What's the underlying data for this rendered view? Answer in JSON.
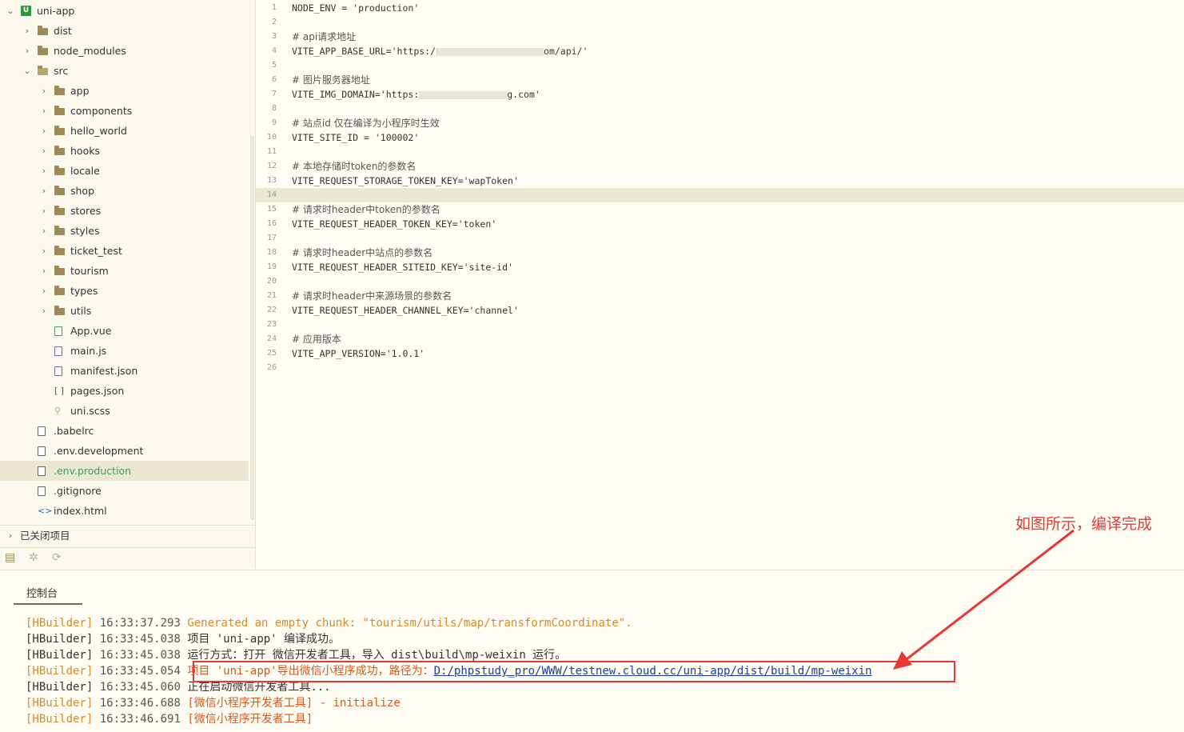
{
  "sidebar": {
    "project": {
      "label": "uni-app",
      "badge": "U"
    },
    "items": [
      {
        "label": "dist",
        "type": "folder",
        "expanded": false
      },
      {
        "label": "node_modules",
        "type": "folder",
        "expanded": false
      },
      {
        "label": "src",
        "type": "folder",
        "expanded": true
      },
      {
        "label": "app",
        "type": "folder",
        "expanded": false
      },
      {
        "label": "components",
        "type": "folder",
        "expanded": false
      },
      {
        "label": "hello_world",
        "type": "folder",
        "expanded": false
      },
      {
        "label": "hooks",
        "type": "folder",
        "expanded": false
      },
      {
        "label": "locale",
        "type": "folder",
        "expanded": false
      },
      {
        "label": "shop",
        "type": "folder",
        "expanded": false
      },
      {
        "label": "stores",
        "type": "folder",
        "expanded": false
      },
      {
        "label": "styles",
        "type": "folder",
        "expanded": false
      },
      {
        "label": "ticket_test",
        "type": "folder",
        "expanded": false
      },
      {
        "label": "tourism",
        "type": "folder",
        "expanded": false
      },
      {
        "label": "types",
        "type": "folder",
        "expanded": false
      },
      {
        "label": "utils",
        "type": "folder",
        "expanded": false
      },
      {
        "label": "App.vue",
        "type": "vue-file"
      },
      {
        "label": "main.js",
        "type": "js-file"
      },
      {
        "label": "manifest.json",
        "type": "manifest-file"
      },
      {
        "label": "pages.json",
        "type": "json-file",
        "icon_text": "[ ]"
      },
      {
        "label": "uni.scss",
        "type": "scss-file"
      },
      {
        "label": ".babelrc",
        "type": "file"
      },
      {
        "label": ".env.development",
        "type": "file"
      },
      {
        "label": ".env.production",
        "type": "file",
        "active": true
      },
      {
        "label": ".gitignore",
        "type": "file"
      },
      {
        "label": "index.html",
        "type": "html-file",
        "icon_text": "<>"
      }
    ],
    "closed_projects": "已关闭项目"
  },
  "editor": {
    "current_line": 14,
    "lines": [
      {
        "n": "1",
        "text": "NODE_ENV = 'production'"
      },
      {
        "n": "2",
        "text": ""
      },
      {
        "n": "3",
        "text": "# api请求地址",
        "comment": true
      },
      {
        "n": "4",
        "text": "VITE_APP_BASE_URL='https:/",
        "redacted": true,
        "tail": "om/api/'"
      },
      {
        "n": "5",
        "text": ""
      },
      {
        "n": "6",
        "text": "# 图片服务器地址",
        "comment": true
      },
      {
        "n": "7",
        "text": "VITE_IMG_DOMAIN='https:",
        "redacted": true,
        "tail": "g.com'"
      },
      {
        "n": "8",
        "text": ""
      },
      {
        "n": "9",
        "text": "# 站点id 仅在编译为小程序时生效",
        "comment": true
      },
      {
        "n": "10",
        "text": "VITE_SITE_ID = '100002'"
      },
      {
        "n": "11",
        "text": ""
      },
      {
        "n": "12",
        "text": "# 本地存储时token的参数名",
        "comment": true
      },
      {
        "n": "13",
        "text": "VITE_REQUEST_STORAGE_TOKEN_KEY='wapToken'"
      },
      {
        "n": "14",
        "text": ""
      },
      {
        "n": "15",
        "text": "# 请求时header中token的参数名",
        "comment": true
      },
      {
        "n": "16",
        "text": "VITE_REQUEST_HEADER_TOKEN_KEY='token'"
      },
      {
        "n": "17",
        "text": ""
      },
      {
        "n": "18",
        "text": "# 请求时header中站点的参数名",
        "comment": true
      },
      {
        "n": "19",
        "text": "VITE_REQUEST_HEADER_SITEID_KEY='site-id'"
      },
      {
        "n": "20",
        "text": ""
      },
      {
        "n": "21",
        "text": "# 请求时header中来源场景的参数名",
        "comment": true
      },
      {
        "n": "22",
        "text": "VITE_REQUEST_HEADER_CHANNEL_KEY='channel'"
      },
      {
        "n": "23",
        "text": ""
      },
      {
        "n": "24",
        "text": "# 应用版本",
        "comment": true
      },
      {
        "n": "25",
        "text": "VITE_APP_VERSION='1.0.1'"
      },
      {
        "n": "26",
        "text": ""
      }
    ]
  },
  "console": {
    "tab_label": "控制台",
    "lines": [
      {
        "source": "[HBuilder]",
        "time": "16:33:37.293",
        "message": "Generated an empty chunk: \"tourism/utils/map/transformCoordinate\".",
        "level": "orange"
      },
      {
        "source": "[HBuilder]",
        "time": "16:33:45.038",
        "message": "项目 'uni-app' 编译成功。",
        "level": "info"
      },
      {
        "source": "[HBuilder]",
        "time": "16:33:45.038",
        "message": "运行方式：打开 微信开发者工具，导入 dist\\build\\mp-weixin 运行。",
        "level": "info"
      },
      {
        "source": "[HBuilder]",
        "time": "16:33:45.054",
        "message": "项目 'uni-app'导出微信小程序成功，路径为：",
        "link": "D:/phpstudy_pro/WWW/testnew.cloud.cc/uni-app/dist/build/mp-weixin",
        "level": "warn"
      },
      {
        "source": "[HBuilder]",
        "time": "16:33:45.060",
        "message": "正在启动微信开发者工具...",
        "level": "info"
      },
      {
        "source": "[HBuilder]",
        "time": "16:33:46.688",
        "message": "[微信小程序开发者工具] - initialize",
        "level": "warn"
      },
      {
        "source": "[HBuilder]",
        "time": "16:33:46.691",
        "message": "[微信小程序开发者工具]",
        "level": "warn"
      }
    ]
  },
  "annotation": {
    "text": "如图所示，编译完成",
    "color": "#e53935"
  },
  "colors": {
    "background": "#fffdf3",
    "active_file": "#3d9e5a",
    "warn_text": "#d6581c",
    "link": "#1d3e9e"
  }
}
